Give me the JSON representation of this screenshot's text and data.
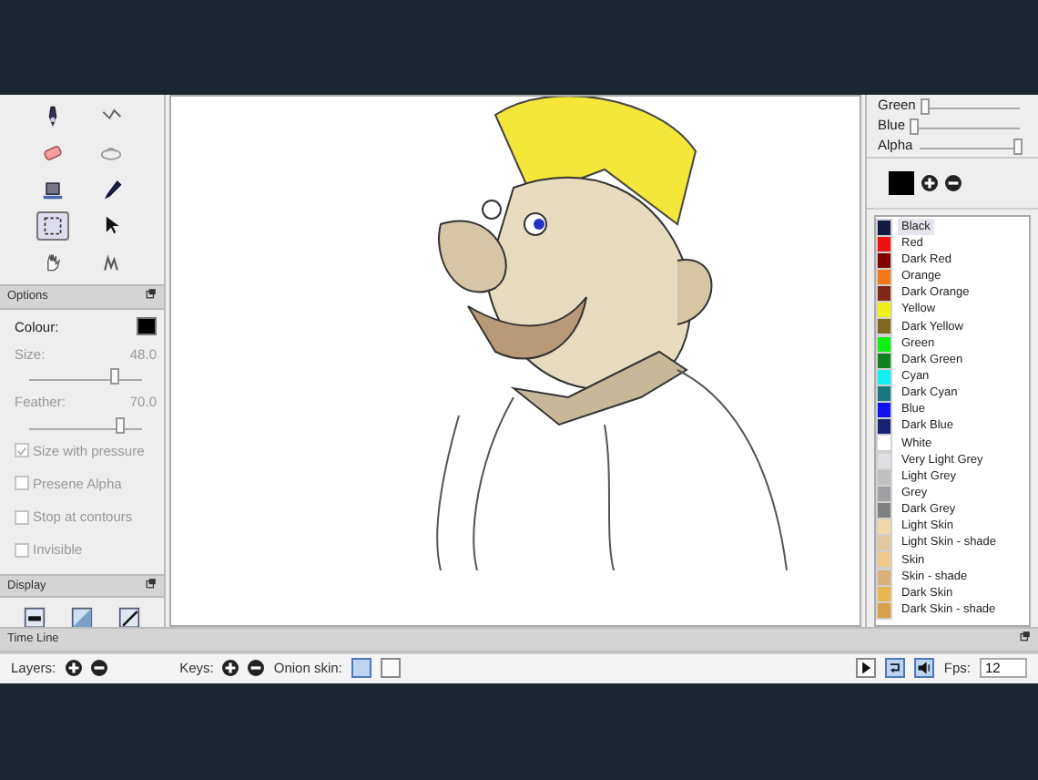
{
  "tools": [
    {
      "kind": "pen",
      "selected": false
    },
    {
      "kind": "polyline",
      "selected": false
    },
    {
      "kind": "eraser",
      "selected": false
    },
    {
      "kind": "clear",
      "selected": false
    },
    {
      "kind": "bucket",
      "selected": false
    },
    {
      "kind": "eyedropper",
      "selected": false
    },
    {
      "kind": "select",
      "selected": true
    },
    {
      "kind": "pointer",
      "selected": false
    },
    {
      "kind": "hand",
      "selected": false
    },
    {
      "kind": "smudge",
      "selected": false
    }
  ],
  "options": {
    "title": "Options",
    "colour_label": "Colour:",
    "sliders": [
      {
        "label": "Size:",
        "reading": "48.0",
        "level": 0.75
      },
      {
        "label": "Feather:",
        "reading": "70.0",
        "level": 0.8
      }
    ],
    "checkboxes": [
      {
        "label": "Size with pressure",
        "checked": true,
        "disabled": true
      },
      {
        "label": "Presene Alpha",
        "checked": false,
        "disabled": true
      },
      {
        "label": "Stop at contours",
        "checked": false,
        "disabled": true
      },
      {
        "label": "Invisible",
        "checked": false,
        "disabled": true
      }
    ]
  },
  "display": {
    "title": "Display",
    "buttons": [
      {
        "kind": "outline"
      },
      {
        "kind": "gradient"
      },
      {
        "kind": "line"
      }
    ]
  },
  "color_sliders": [
    {
      "label": "Green",
      "level": 0.0
    },
    {
      "label": "Blue",
      "level": 0.0
    },
    {
      "label": "Alpha",
      "level": 1.0
    }
  ],
  "palette": [
    {
      "name": "Black",
      "color": "#141b40",
      "selected": true
    },
    {
      "name": "Red",
      "color": "#f01010",
      "selected": false
    },
    {
      "name": "Dark Red",
      "color": "#800000",
      "selected": false
    },
    {
      "name": "Orange",
      "color": "#f07818",
      "selected": false
    },
    {
      "name": "Dark Orange",
      "color": "#802818",
      "selected": false
    },
    {
      "name": "Yellow",
      "color": "#f0f018",
      "selected": false
    },
    {
      "name": "Dark Yellow",
      "color": "#806820",
      "selected": false
    },
    {
      "name": "Green",
      "color": "#10f010",
      "selected": false
    },
    {
      "name": "Dark Green",
      "color": "#108020",
      "selected": false
    },
    {
      "name": "Cyan",
      "color": "#10f0f0",
      "selected": false
    },
    {
      "name": "Dark Cyan",
      "color": "#187880",
      "selected": false
    },
    {
      "name": "Blue",
      "color": "#1010f0",
      "selected": false
    },
    {
      "name": "Dark Blue",
      "color": "#182070",
      "selected": false
    },
    {
      "name": "White",
      "color": "#ffffff",
      "selected": false
    },
    {
      "name": "Very Light Grey",
      "color": "#e0e0e4",
      "selected": false
    },
    {
      "name": "Light Grey",
      "color": "#c0c0c0",
      "selected": false
    },
    {
      "name": "Grey",
      "color": "#a0a0a4",
      "selected": false
    },
    {
      "name": "Dark Grey",
      "color": "#808080",
      "selected": false
    },
    {
      "name": "Light Skin",
      "color": "#f0d8a8",
      "selected": false
    },
    {
      "name": "Light Skin - shade",
      "color": "#e0c8a0",
      "selected": false
    },
    {
      "name": "Skin",
      "color": "#f0c888",
      "selected": false
    },
    {
      "name": "Skin - shade",
      "color": "#d8b078",
      "selected": false
    },
    {
      "name": "Dark Skin",
      "color": "#e8b850",
      "selected": false
    },
    {
      "name": "Dark Skin - shade",
      "color": "#d8a048",
      "selected": false
    }
  ],
  "timeline": {
    "title": "Time Line",
    "layers_label": "Layers:",
    "keys_label": "Keys:",
    "onion_label": "Onion skin:",
    "onion": [
      {
        "on": true
      },
      {
        "on": false
      }
    ],
    "controls": [
      {
        "kind": "play",
        "on": false
      },
      {
        "kind": "loop",
        "on": true
      },
      {
        "kind": "sound",
        "on": true
      }
    ],
    "fps_label": "Fps:",
    "fps": "12"
  }
}
